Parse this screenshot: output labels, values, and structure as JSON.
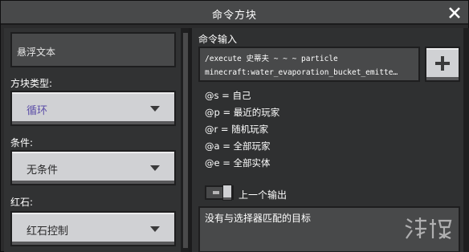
{
  "window": {
    "title": "命令方块"
  },
  "left": {
    "hover_note": "悬浮文本",
    "block_type": {
      "label": "方块类型:",
      "value": "循环"
    },
    "condition": {
      "label": "条件:",
      "value": "无条件"
    },
    "redstone": {
      "label": "红石:",
      "value": "红石控制"
    }
  },
  "right": {
    "command_label": "命令输入",
    "command_lines": [
      "/execute 史蒂夫 ~ ~ ~ particle",
      "minecraft:water_evaporation_bucket_emitte…"
    ],
    "selectors": [
      "@s = 自己",
      "@p = 最近的玩家",
      "@r = 随机玩家",
      "@a = 全部玩家",
      "@e = 全部实体"
    ],
    "previous_output_label": "上一个输出",
    "output_text": "没有与选择器匹配的目标"
  },
  "icons": {
    "close": "close-icon",
    "plus": "plus-icon",
    "dropdown": "chevron-down-icon"
  },
  "colors": {
    "block_type_value": "#5d4fa8",
    "panel": "#313233",
    "button": "#d0d1d4"
  }
}
